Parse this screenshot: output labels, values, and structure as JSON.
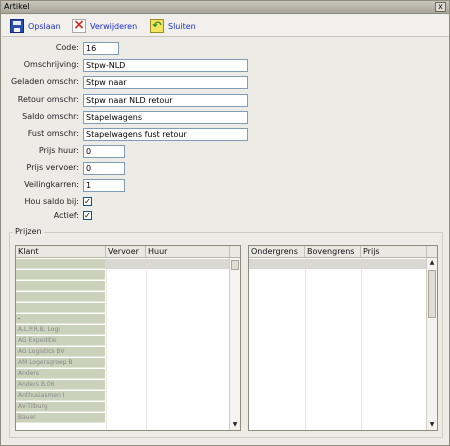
{
  "window": {
    "title": "Artikel",
    "close_glyph": "x"
  },
  "toolbar": {
    "save_label": "Opslaan",
    "delete_label": "Verwijderen",
    "close_label": "Sluiten",
    "save_icon": "floppy-disk-icon",
    "delete_icon": "red-x-icon",
    "close_icon": "exit-door-icon"
  },
  "form": {
    "code_label": "Code:",
    "code_value": "16",
    "omschrijving_label": "Omschrijving:",
    "omschrijving_value": "Stpw-NLD",
    "geladen_label": "Geladen omschr:",
    "geladen_value": "Stpw naar",
    "retour_label": "Retour omschr:",
    "retour_value": "Stpw naar NLD retour",
    "saldo_label": "Saldo omschr:",
    "saldo_value": "Stapelwagens",
    "fust_label": "Fust omschr:",
    "fust_value": "Stapelwagens fust retour",
    "prijs_huur_label": "Prijs huur:",
    "prijs_huur_value": "0",
    "prijs_vervoer_label": "Prijs vervoer:",
    "prijs_vervoer_value": "0",
    "veilingkarren_label": "Veilingkarren:",
    "veilingkarren_value": "1",
    "hou_saldo_label": "Hou saldo bij:",
    "hou_saldo_checked": true,
    "actief_label": "Actief:",
    "actief_checked": true
  },
  "prijzen": {
    "legend": "Prijzen",
    "left_grid": {
      "columns": [
        "Klant",
        "Vervoer",
        "Huur"
      ],
      "klant_rows": [
        "",
        "",
        "",
        "",
        "",
        "-",
        "A.L.P.R.B. Logi",
        "AG Expeditie",
        "AG Logistics BV",
        "AM Logersgroep B",
        "Anders",
        "Anders B.06",
        "Anthusiasmen I",
        "AV-Tilburg",
        "Bauer"
      ]
    },
    "right_grid": {
      "columns": [
        "Ondergrens",
        "Bovengrens",
        "Prijs"
      ]
    }
  }
}
